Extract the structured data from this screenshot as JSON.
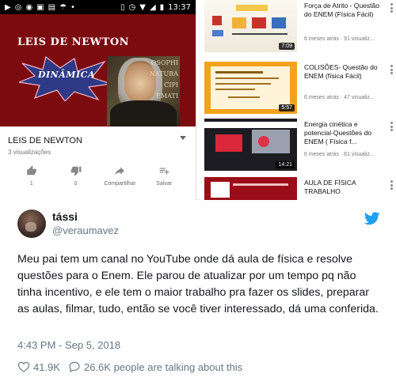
{
  "status_bar": {
    "time": "13:37"
  },
  "player": {
    "title_overlay": "LEIS DE NEWTON",
    "burst_label": "DINÂMICA",
    "portrait_text": "OSOPHI\nNATURA\nCIPI\nEMATI"
  },
  "video_meta": {
    "title": "LEIS DE NEWTON",
    "views": "3 visualizações",
    "actions": [
      {
        "label": "1",
        "icon": "thumbs-up-icon"
      },
      {
        "label": "0",
        "icon": "thumbs-down-icon"
      },
      {
        "label": "Compartilhar",
        "icon": "share-icon"
      },
      {
        "label": "Salvar",
        "icon": "playlist-add-icon"
      }
    ]
  },
  "related": [
    {
      "title": "Força de Atrito - Questão do ENEM (Física Fácil)",
      "meta": "6 meses atrás · 91 visualiz...",
      "duration": "7:09"
    },
    {
      "title": "COLISÕES- Questão do ENEM (física Fácil)",
      "meta": "6 meses atrás · 47 visualiz...",
      "duration": "5:57"
    },
    {
      "title": "Energia cinética e potencial-Questões do ENEM ( Física f...",
      "meta": "6 meses atrás · 61 visualiz...",
      "duration": "14:21"
    },
    {
      "title": "AULA DE FÍSICA TRABALHO",
      "meta": "",
      "duration": ""
    }
  ],
  "tweet": {
    "name": "tássi",
    "handle": "@veraumavez",
    "body": "Meu pai tem um canal no YouTube onde dá aula de física e resolve questões para o Enem. Ele parou de atualizar por um tempo pq não tinha incentivo, e ele tem o maior trabalho pra fazer os slides, preparar as aulas, filmar, tudo, então se você tiver interessado, dá uma conferida.",
    "timestamp": "4:43 PM - Sep 5, 2018",
    "likes": "41.9K",
    "replies_text": "26.6K people are talking about this"
  },
  "colors": {
    "video_bg": "#7c0b10",
    "twitter_blue": "#1da1f2",
    "text_secondary": "#657786"
  }
}
